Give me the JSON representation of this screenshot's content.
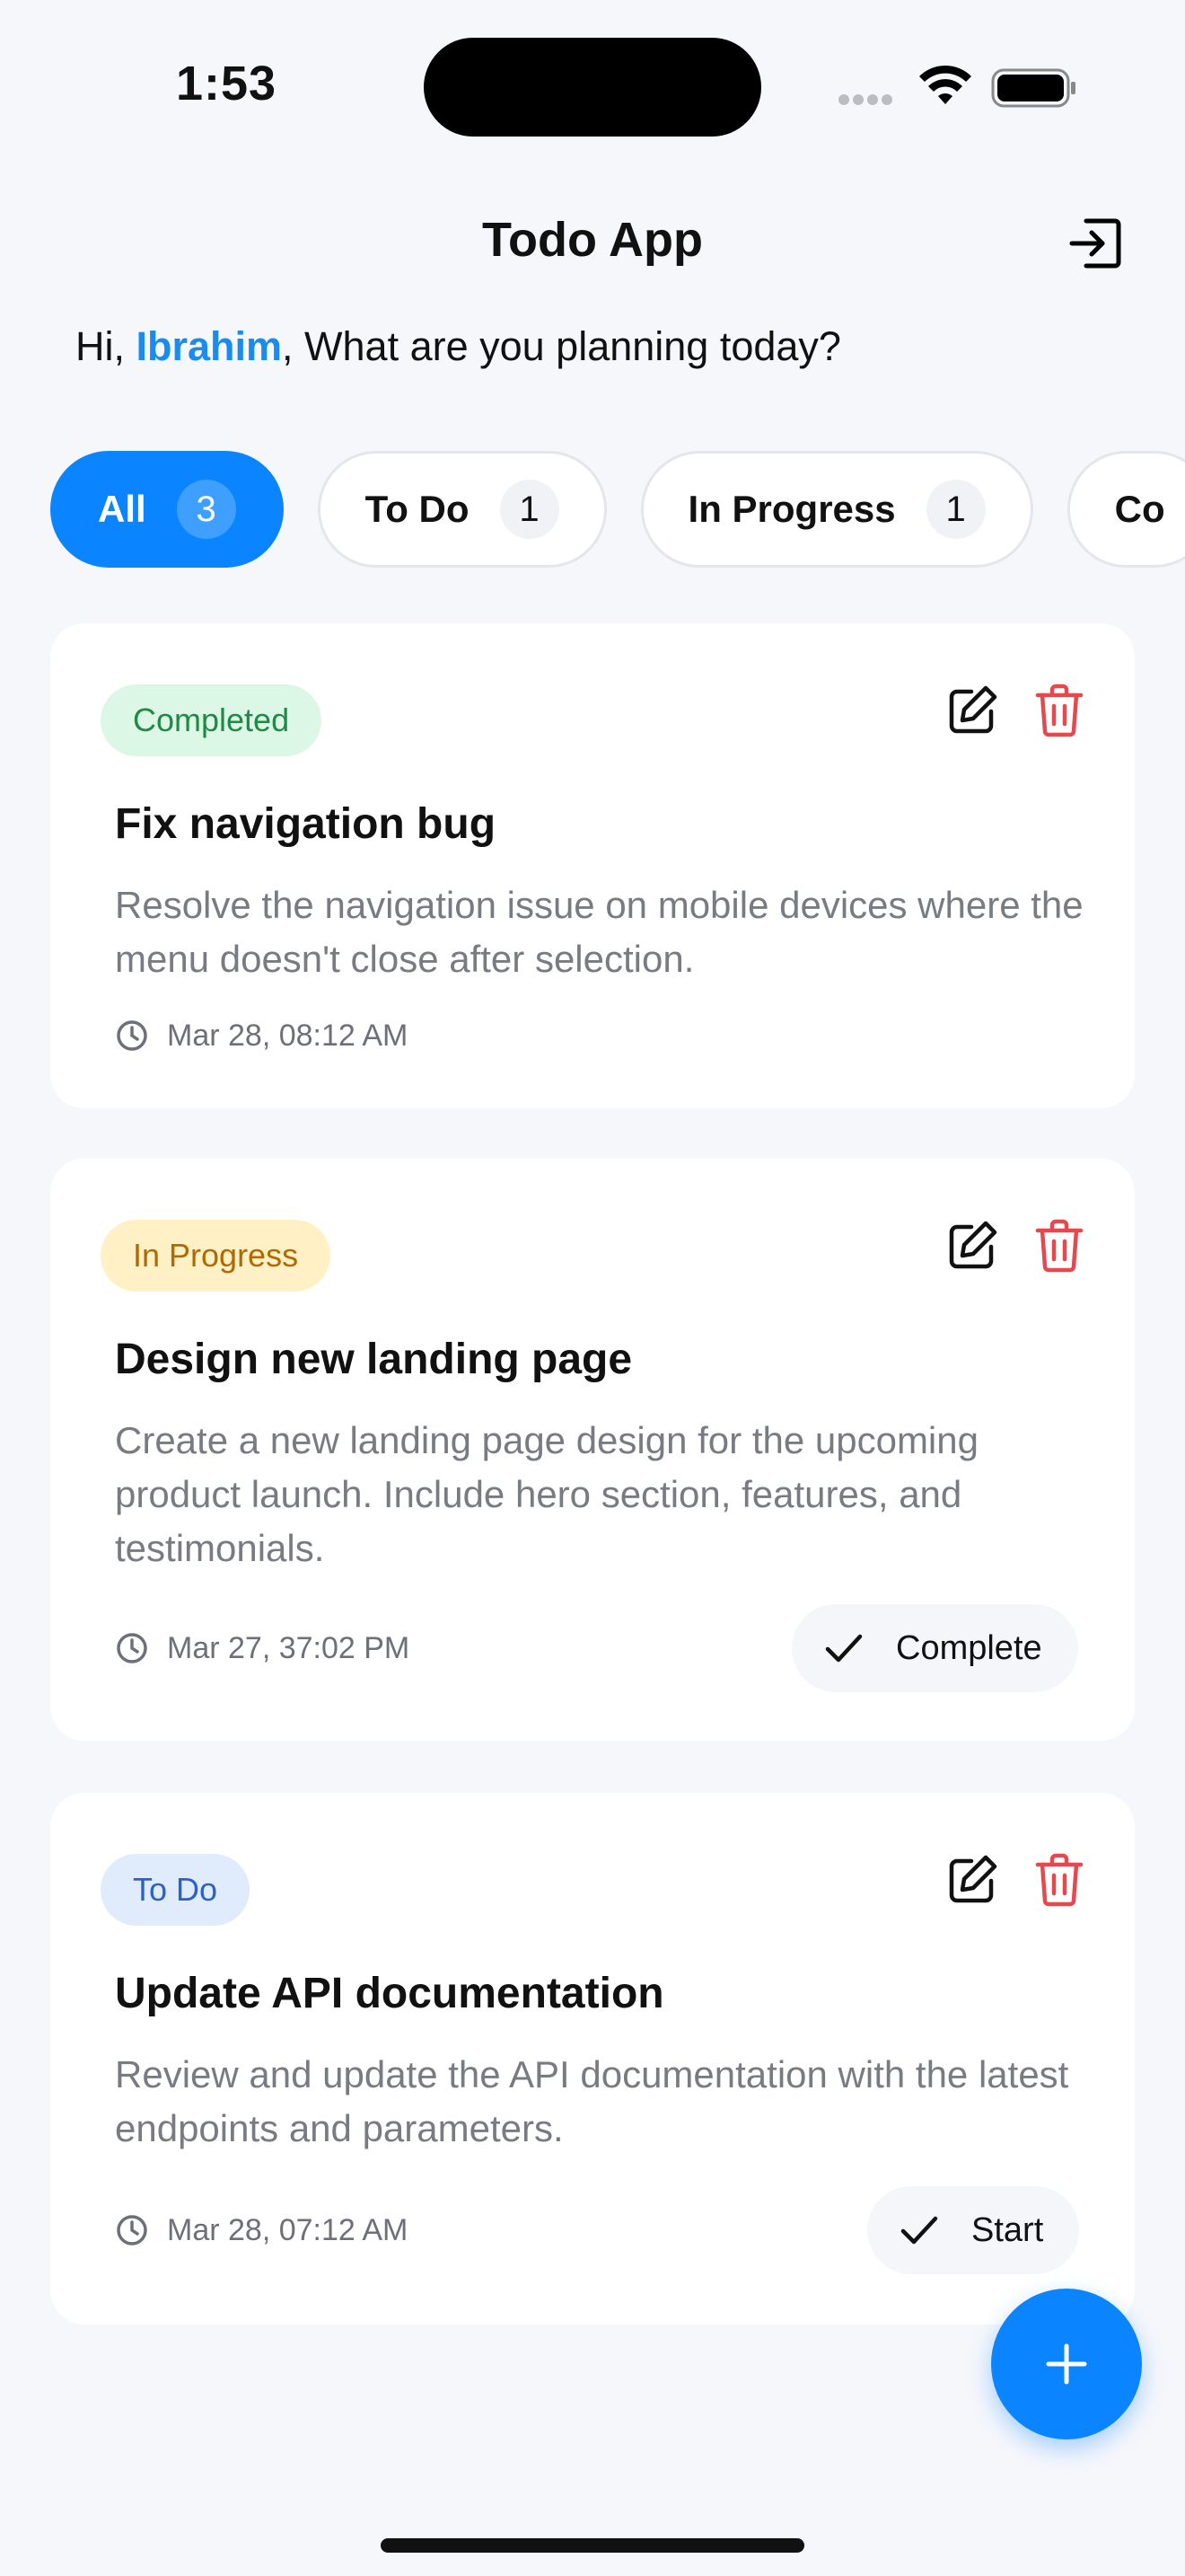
{
  "status_bar": {
    "time": "1:53"
  },
  "header": {
    "title": "Todo App",
    "logout_icon": "logout-icon"
  },
  "greeting": {
    "prefix": "Hi, ",
    "user": "Ibrahim",
    "suffix": ", What are you planning today?"
  },
  "tabs": [
    {
      "label": "All",
      "count": "3",
      "active": true
    },
    {
      "label": "To Do",
      "count": "1",
      "active": false
    },
    {
      "label": "In Progress",
      "count": "1",
      "active": false
    },
    {
      "label": "Co",
      "count": "",
      "active": false
    }
  ],
  "tasks": [
    {
      "status": "Completed",
      "title": "Fix navigation bug",
      "description": "Resolve the navigation issue on mobile devices where the menu doesn't close after selection.",
      "date": "Mar 28, 08:12 AM",
      "action": ""
    },
    {
      "status": "In Progress",
      "title": "Design new landing page",
      "description": "Create a new landing page design for the upcoming product launch. Include hero section, features, and testimonials.",
      "date": "Mar 27, 37:02 PM",
      "action": "Complete"
    },
    {
      "status": "To Do",
      "title": "Update API documentation",
      "description": "Review and update the API documentation with the latest endpoints and parameters.",
      "date": "Mar 28, 07:12 AM",
      "action": "Start"
    }
  ],
  "colors": {
    "accent": "#0a84ff",
    "completed_bg": "#ddf7e6",
    "in_progress_bg": "#fff0c6",
    "todo_bg": "#e0ecfc",
    "delete": "#e5484d"
  },
  "fab": {
    "icon": "plus-icon"
  }
}
